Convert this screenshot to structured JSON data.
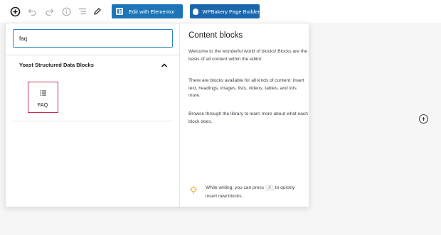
{
  "toolbar": {
    "icons": [
      "add-block-icon",
      "undo-icon",
      "redo-icon",
      "info-icon",
      "list-view-icon",
      "edit-pencil-icon"
    ],
    "elementor_label": "Edit with Elementor",
    "wpbakery_label": "WPBakery Page Builder"
  },
  "inserter": {
    "search": {
      "value": "faq"
    },
    "panel": {
      "title": "Yoast Structured Data Blocks",
      "collapse_icon": "chevron-up-icon",
      "blocks": [
        {
          "label": "FAQ",
          "icon": "list-icon"
        }
      ]
    },
    "info": {
      "title": "Content blocks",
      "paragraphs": [
        "Welcome to the wonderful world of blocks! Blocks are the basis of all content within the editor.",
        "There are blocks available for all kinds of content: insert text, headings, images, lists, videos, tables, and lots more.",
        "Browse through the library to learn more about what each block does."
      ],
      "tip": {
        "icon": "lightbulb-icon",
        "before": "While writing, you can press",
        "key": "/",
        "after": "to quickly insert new blocks."
      }
    }
  },
  "canvas": {
    "add_block_icon": "plus-circle-icon"
  },
  "colors": {
    "elementor_button": "#1d75b9",
    "wpbakery_button": "#1a67ad",
    "search_focus_border": "#2d7fc1",
    "selected_block_border": "#c5304f",
    "tip_icon": "#f0b429"
  }
}
